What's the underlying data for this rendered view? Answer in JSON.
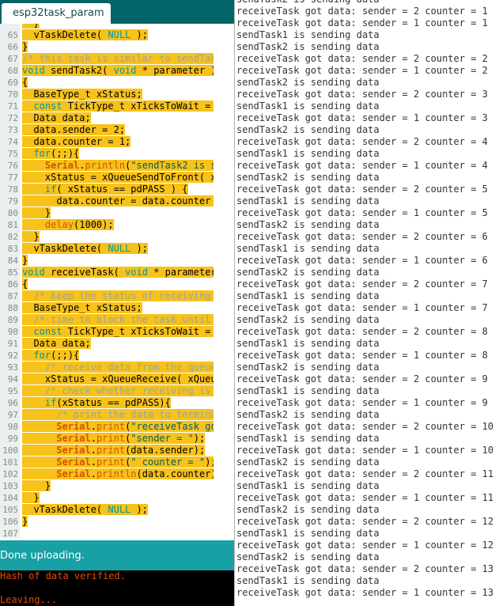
{
  "ide": {
    "tab_label": "esp32task_param",
    "status": "Done uploading.",
    "console": [
      "Hash of data verified.",
      "",
      "Leaving..."
    ],
    "code_lines": [
      {
        "n": "",
        "t": "  }"
      },
      {
        "n": "65",
        "t": "  vTaskDelete( NULL );"
      },
      {
        "n": "66",
        "t": "}"
      },
      {
        "n": "67",
        "t": "/* this task is similar to sendTask1 */"
      },
      {
        "n": "68",
        "t": "void sendTask2( void * parameter )"
      },
      {
        "n": "69",
        "t": "{"
      },
      {
        "n": "70",
        "t": "  BaseType_t xStatus;"
      },
      {
        "n": "71",
        "t": "  const TickType_t xTicksToWait = pdMS"
      },
      {
        "n": "72",
        "t": "  Data data;"
      },
      {
        "n": "73",
        "t": "  data.sender = 2;"
      },
      {
        "n": "74",
        "t": "  data.counter = 1;"
      },
      {
        "n": "75",
        "t": "  for(;;){"
      },
      {
        "n": "76",
        "t": "    Serial.println(\"sendTask2 is sendi"
      },
      {
        "n": "77",
        "t": "    xStatus = xQueueSendToFront( xQueu"
      },
      {
        "n": "78",
        "t": "    if( xStatus == pdPASS ) {"
      },
      {
        "n": "79",
        "t": "      data.counter = data.counter + 1;"
      },
      {
        "n": "80",
        "t": "    }"
      },
      {
        "n": "81",
        "t": "    delay(1000);"
      },
      {
        "n": "82",
        "t": "  }"
      },
      {
        "n": "83",
        "t": "  vTaskDelete( NULL );"
      },
      {
        "n": "84",
        "t": "}"
      },
      {
        "n": "85",
        "t": "void receiveTask( void * parameter )"
      },
      {
        "n": "86",
        "t": "{"
      },
      {
        "n": "87",
        "t": "  /* keep the status of receiving data"
      },
      {
        "n": "88",
        "t": "  BaseType_t xStatus;"
      },
      {
        "n": "89",
        "t": "  /* time to block the task until data"
      },
      {
        "n": "90",
        "t": "  const TickType_t xTicksToWait = pdMS"
      },
      {
        "n": "91",
        "t": "  Data data;"
      },
      {
        "n": "92",
        "t": "  for(;;){"
      },
      {
        "n": "93",
        "t": "    /* receive data from the queue */"
      },
      {
        "n": "94",
        "t": "    xStatus = xQueueReceive( xQueue, &"
      },
      {
        "n": "95",
        "t": "    /* check whether receiving is ok o"
      },
      {
        "n": "96",
        "t": "    if(xStatus == pdPASS){"
      },
      {
        "n": "97",
        "t": "      /* print the data to terminal */"
      },
      {
        "n": "98",
        "t": "      Serial.print(\"receiveTask got da"
      },
      {
        "n": "99",
        "t": "      Serial.print(\"sender = \");"
      },
      {
        "n": "100",
        "t": "      Serial.print(data.sender);"
      },
      {
        "n": "101",
        "t": "      Serial.print(\" counter = \");"
      },
      {
        "n": "102",
        "t": "      Serial.println(data.counter);"
      },
      {
        "n": "103",
        "t": "    }"
      },
      {
        "n": "104",
        "t": "  }"
      },
      {
        "n": "105",
        "t": "  vTaskDelete( NULL );"
      },
      {
        "n": "106",
        "t": "}"
      },
      {
        "n": "107",
        "t": ""
      }
    ]
  },
  "serial": {
    "lines": [
      "sendTask2 is sending data",
      "receiveTask got data: sender = 2 counter = 1",
      "receiveTask got data: sender = 1 counter = 1",
      "sendTask1 is sending data",
      "sendTask2 is sending data",
      "receiveTask got data: sender = 2 counter = 2",
      "receiveTask got data: sender = 1 counter = 2",
      "sendTask2 is sending data",
      "receiveTask got data: sender = 2 counter = 3",
      "sendTask1 is sending data",
      "receiveTask got data: sender = 1 counter = 3",
      "sendTask2 is sending data",
      "receiveTask got data: sender = 2 counter = 4",
      "sendTask1 is sending data",
      "receiveTask got data: sender = 1 counter = 4",
      "sendTask2 is sending data",
      "receiveTask got data: sender = 2 counter = 5",
      "sendTask1 is sending data",
      "receiveTask got data: sender = 1 counter = 5",
      "sendTask2 is sending data",
      "receiveTask got data: sender = 2 counter = 6",
      "sendTask1 is sending data",
      "receiveTask got data: sender = 1 counter = 6",
      "sendTask2 is sending data",
      "receiveTask got data: sender = 2 counter = 7",
      "sendTask1 is sending data",
      "receiveTask got data: sender = 1 counter = 7",
      "sendTask2 is sending data",
      "receiveTask got data: sender = 2 counter = 8",
      "sendTask1 is sending data",
      "receiveTask got data: sender = 1 counter = 8",
      "sendTask2 is sending data",
      "receiveTask got data: sender = 2 counter = 9",
      "sendTask1 is sending data",
      "receiveTask got data: sender = 1 counter = 9",
      "sendTask2 is sending data",
      "receiveTask got data: sender = 2 counter = 10",
      "sendTask1 is sending data",
      "receiveTask got data: sender = 1 counter = 10",
      "sendTask2 is sending data",
      "receiveTask got data: sender = 2 counter = 11",
      "sendTask1 is sending data",
      "receiveTask got data: sender = 1 counter = 11",
      "sendTask2 is sending data",
      "receiveTask got data: sender = 2 counter = 12",
      "sendTask1 is sending data",
      "receiveTask got data: sender = 1 counter = 12",
      "sendTask2 is sending data",
      "receiveTask got data: sender = 2 counter = 13",
      "sendTask1 is sending data",
      "receiveTask got data: sender = 1 counter = 13"
    ]
  },
  "colors": {
    "tabbar": "#006468",
    "statusbar": "#17a1a5",
    "selection": "#f7c21a",
    "console_text": "#e34c00"
  }
}
